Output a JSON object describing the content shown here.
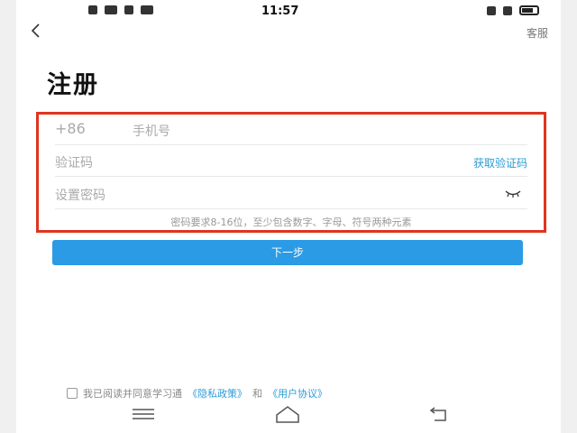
{
  "status_bar": {
    "time": "11:57"
  },
  "header": {
    "back_icon": "chevron-left-icon",
    "help_label": "客服"
  },
  "page": {
    "title": "注册"
  },
  "form": {
    "phone_code": "+86",
    "phone_placeholder": "手机号",
    "code_placeholder": "验证码",
    "get_code_label": "获取验证码",
    "password_placeholder": "设置密码",
    "password_toggle_icon": "eye-closed-icon",
    "password_hint": "密码要求8-16位，至少包含数字、字母、符号两种元素",
    "highlight_color": "#e0341f"
  },
  "actions": {
    "next_label": "下一步",
    "next_color": "#2b9be6"
  },
  "agreement": {
    "prefix": "我已阅读并同意学习通",
    "privacy_link": "《隐私政策》",
    "and_text": "和",
    "user_link": "《用户协议》",
    "checked": false
  },
  "nav": {
    "menu_icon": "menu-icon",
    "home_icon": "home-icon",
    "back_icon": "back-icon"
  }
}
